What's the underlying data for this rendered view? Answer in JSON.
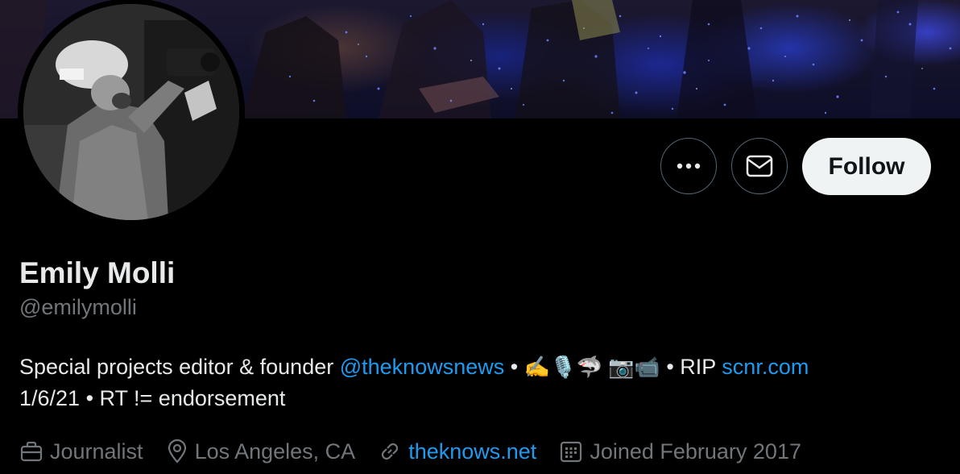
{
  "profile": {
    "display_name": "Emily Molli",
    "handle": "@emilymolli",
    "bio": {
      "text_1": "Special projects editor & founder ",
      "mention": "@theknowsnews",
      "text_2": " • ",
      "emojis": "✍️🎙️🦈 📷📹",
      "text_3": " • RIP ",
      "link": "scnr.com",
      "line_2": "1/6/21 • RT != endorsement"
    },
    "meta": {
      "profession": "Journalist",
      "location": "Los Angeles, CA",
      "website": "theknows.net",
      "joined": "Joined February 2017"
    }
  },
  "actions": {
    "follow_label": "Follow",
    "more_icon": "ellipsis-icon",
    "message_icon": "envelope-icon"
  },
  "colors": {
    "background": "#000000",
    "text_primary": "#e7e9ea",
    "text_secondary": "#71767b",
    "link": "#1d9bf0",
    "follow_button_bg": "#eff3f4",
    "button_border": "#536471"
  }
}
